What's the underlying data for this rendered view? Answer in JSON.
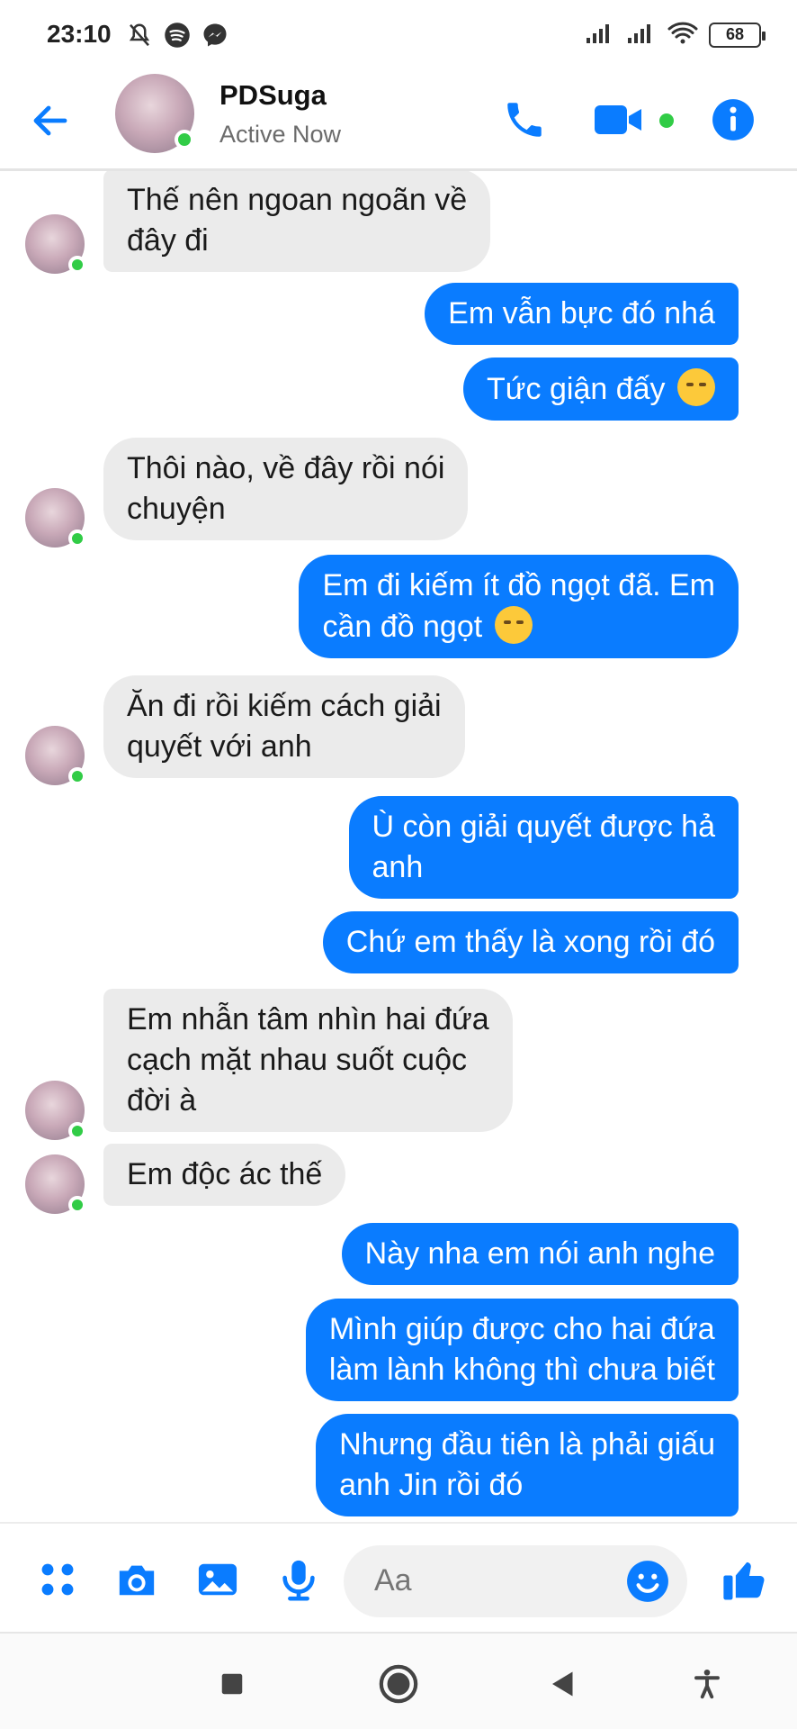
{
  "status_bar": {
    "time": "23:10",
    "battery": "68",
    "icons_left": [
      "mute-icon",
      "spotify-icon",
      "messenger-icon"
    ],
    "icons_right": [
      "signal-icon",
      "signal-icon",
      "wifi-icon",
      "battery-icon"
    ]
  },
  "header": {
    "name": "PDSuga",
    "status": "Active Now",
    "icons": [
      "back-arrow-icon",
      "phone-icon",
      "video-camera-icon",
      "info-icon"
    ]
  },
  "messages": [
    {
      "from": "them",
      "text": "Thế nên ngoan ngoãn về\nđây đi"
    },
    {
      "from": "me",
      "text": "Em vẫn bực đó nhá"
    },
    {
      "from": "me",
      "text": "Tức giận đấy",
      "emoji": "angry-face"
    },
    {
      "from": "them",
      "text": "Thôi nào, về đây rồi nói\nchuyện"
    },
    {
      "from": "me",
      "text": "Em đi kiếm ít đồ ngọt đã. Em\ncần đồ ngọt",
      "emoji": "pensive-face"
    },
    {
      "from": "them",
      "text": "Ăn đi rồi kiếm cách giải\nquyết với anh"
    },
    {
      "from": "me",
      "text": "Ù còn giải quyết được hả\nanh"
    },
    {
      "from": "me",
      "text": "Chứ em thấy là xong rồi đó"
    },
    {
      "from": "them",
      "text": "Em nhẫn tâm nhìn hai đứa\ncạch mặt nhau suốt cuộc\nđời à"
    },
    {
      "from": "them",
      "text": "Em độc ác thế"
    },
    {
      "from": "me",
      "text": "Này nha em nói anh nghe"
    },
    {
      "from": "me",
      "text": "Mình giúp được cho hai đứa\nlàm lành không thì chưa biết"
    },
    {
      "from": "me",
      "text": "Nhưng đầu tiên là phải giấu\nanh Jin rồi đó"
    }
  ],
  "composer": {
    "placeholder": "Aa",
    "icons": [
      "apps-grid-icon",
      "camera-icon",
      "gallery-icon",
      "microphone-icon",
      "emoji-icon",
      "thumbs-up-icon"
    ]
  },
  "navbar": {
    "icons": [
      "recent-apps-icon",
      "home-icon",
      "back-icon",
      "accessibility-icon"
    ]
  },
  "colors": {
    "accent": "#0a7cff",
    "incoming_bubble": "#ebebeb",
    "online": "#31cc46"
  }
}
